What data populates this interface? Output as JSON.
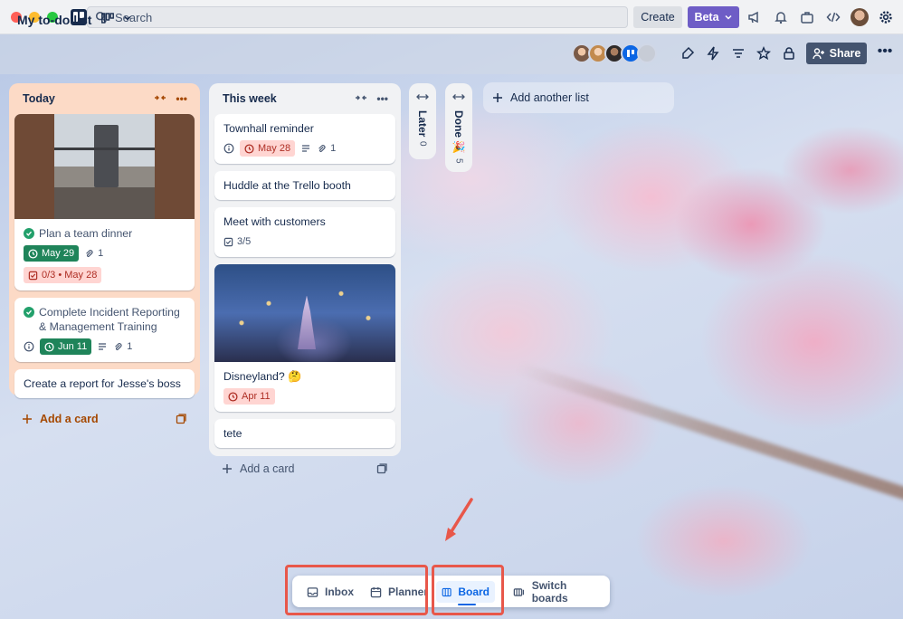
{
  "colors": {
    "today_list_bg": "#fcdac6",
    "beta_button": "#6e5dc6",
    "share_button": "#44546f",
    "date_green": "#1f845a",
    "date_red_bg": "#ffd5d2",
    "accent_blue": "#0c66e4",
    "highlight_red": "#e8574a"
  },
  "topbar": {
    "search_placeholder": "Search",
    "create_label": "Create",
    "beta_label": "Beta",
    "icons": [
      "megaphone-icon",
      "bell-icon",
      "briefcase-icon",
      "code-icon",
      "avatar",
      "gear-icon"
    ]
  },
  "board": {
    "title": "My to-do list",
    "share_label": "Share",
    "header_icons": [
      "power-up-icon",
      "automation-icon",
      "filter-icon",
      "star-icon",
      "lock-icon",
      "more-icon"
    ]
  },
  "lists": [
    {
      "title": "Today",
      "add_label": "Add a card",
      "cards": [
        {
          "title": "Plan a team dinner",
          "date": "May 29",
          "attachments": "1",
          "checklist": "0/3 • May 28"
        },
        {
          "title": "Complete Incident Reporting & Management Training",
          "date": "Jun 11",
          "attachments": "1"
        },
        {
          "title": "Create a report for Jesse's boss"
        }
      ]
    },
    {
      "title": "This week",
      "add_label": "Add a card",
      "cards": [
        {
          "title": "Townhall reminder",
          "date": "May 28",
          "attachments": "1"
        },
        {
          "title": "Huddle at the Trello booth"
        },
        {
          "title": "Meet with customers",
          "checklist": "3/5"
        },
        {
          "title": "Disneyland? 🤔",
          "date": "Apr 11"
        },
        {
          "title": "tete"
        }
      ]
    }
  ],
  "collapsed_lists": [
    {
      "title": "Later",
      "count": "0"
    },
    {
      "title": "Done 🎉",
      "count": "5"
    }
  ],
  "add_list_label": "Add another list",
  "switcher": {
    "inbox": "Inbox",
    "planner": "Planner",
    "board": "Board",
    "switch_boards": "Switch boards",
    "active": "Board"
  }
}
